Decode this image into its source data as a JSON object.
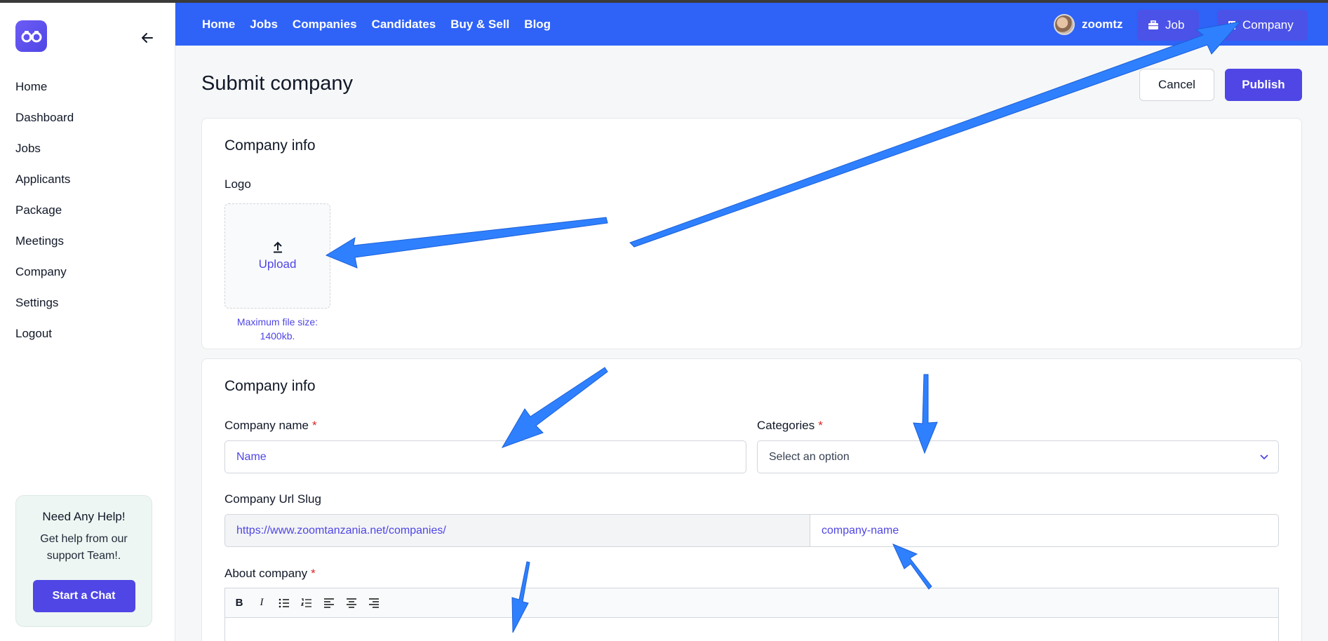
{
  "sidebar": {
    "logo_icon": "binoculars-icon",
    "items": [
      {
        "label": "Home"
      },
      {
        "label": "Dashboard"
      },
      {
        "label": "Jobs"
      },
      {
        "label": "Applicants"
      },
      {
        "label": "Package"
      },
      {
        "label": "Meetings"
      },
      {
        "label": "Company"
      },
      {
        "label": "Settings"
      },
      {
        "label": "Logout"
      }
    ],
    "help": {
      "title": "Need Any Help!",
      "text": "Get help from our support Team!.",
      "button": "Start a Chat"
    }
  },
  "topbar": {
    "nav": [
      "Home",
      "Jobs",
      "Companies",
      "Candidates",
      "Buy & Sell",
      "Blog"
    ],
    "username": "zoomtz",
    "job_button": "Job",
    "company_button": "Company",
    "bg_color": "#2f62f7"
  },
  "page": {
    "title": "Submit company",
    "cancel": "Cancel",
    "publish": "Publish"
  },
  "card1": {
    "title": "Company info",
    "logo_label": "Logo",
    "upload_label": "Upload",
    "upload_hint": "Maximum file size: 1400kb."
  },
  "card2": {
    "title": "Company info",
    "name_label": "Company name",
    "name_placeholder": "Name",
    "categories_label": "Categories",
    "categories_value": "Select an option",
    "slug_label": "Company Url Slug",
    "slug_prefix": "https://www.zoomtanzania.net/companies/",
    "slug_placeholder": "company-name",
    "about_label": "About company",
    "required_mark": "*",
    "toolbar_icons": [
      "bold-icon",
      "italic-icon",
      "bullet-list-icon",
      "numbered-list-icon",
      "align-left-icon",
      "align-center-icon",
      "align-right-icon"
    ]
  },
  "colors": {
    "accent": "#4f46e5",
    "annotation_arrow": "#2f80ff"
  }
}
